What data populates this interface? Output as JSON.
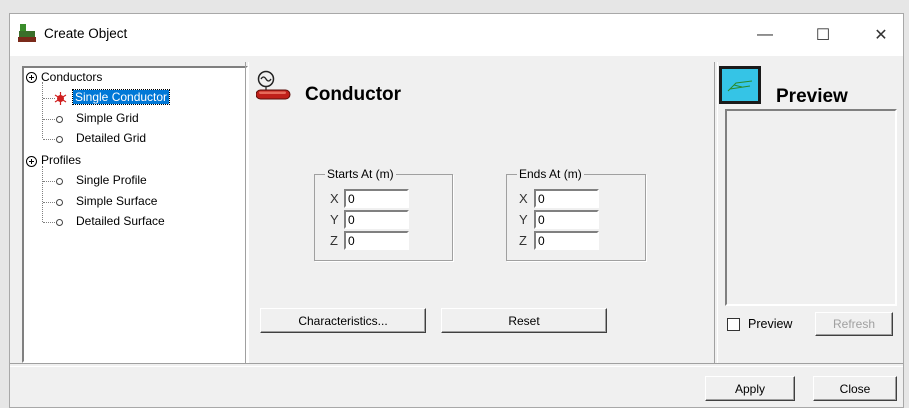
{
  "window": {
    "title": "Create Object"
  },
  "window_controls": {
    "minimize": "—",
    "maximize": "☐",
    "close": "✕"
  },
  "tree": {
    "groups": [
      {
        "label": "Conductors",
        "items": [
          "Single Conductor",
          "Simple Grid",
          "Detailed Grid"
        ]
      },
      {
        "label": "Profiles",
        "items": [
          "Single Profile",
          "Simple Surface",
          "Detailed Surface"
        ]
      }
    ],
    "selected": "Single Conductor"
  },
  "header": {
    "title": "Conductor"
  },
  "starts_at": {
    "label": "Starts At (m)",
    "x": "0",
    "y": "0",
    "z": "0"
  },
  "ends_at": {
    "label": "Ends At (m)",
    "x": "0",
    "y": "0",
    "z": "0"
  },
  "axes": {
    "x": "X",
    "y": "Y",
    "z": "Z"
  },
  "buttons": {
    "characteristics": "Characteristics...",
    "reset": "Reset",
    "apply": "Apply",
    "close": "Close",
    "refresh": "Refresh"
  },
  "preview": {
    "title": "Preview",
    "checkbox_label": "Preview",
    "checked": false
  },
  "colors": {
    "selection": "#0078d7",
    "preview_icon": "#35c4e6",
    "conductor_red": "#c0201a"
  }
}
